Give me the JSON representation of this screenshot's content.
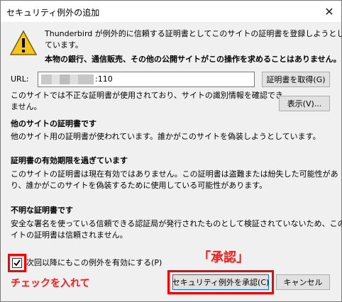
{
  "window": {
    "title": "セキュリティ例外の追加"
  },
  "intro": {
    "line1": "Thunderbird が例外的に信頼する証明書としてこのサイトの証明書を登録しようとし",
    "line2": "ています。",
    "bold": "本物の銀行、通信販売、その他の公開サイトがこの操作を求めることはありません。"
  },
  "url": {
    "label": "URL:",
    "value_suffix": ":110",
    "get_button": "証明書を取得(G)"
  },
  "status": {
    "line1": "このサイトでは不正な証明書が使用されており、サイトの識別情報を確認でき",
    "line2": "ません。",
    "view_button": "表示(V)..."
  },
  "sections": [
    {
      "title": "他のサイトの証明書です",
      "lines": [
        "他のサイト用の証明書が使われています。誰かがこのサイトを偽装しようとしています。"
      ]
    },
    {
      "title": "証明書の有効期限を過ぎています",
      "lines": [
        "このサイトの証明書は現在有効ではありません。この証明書は盗難または紛失した可能性があ",
        "り、誰かがこのサイトを偽装するために使用している可能性があります。"
      ]
    },
    {
      "title": "不明な証明書です",
      "lines": [
        "安全な署名を使っている信頼できる認証局が発行されたものとして検証されていないため、このサ",
        "イトの証明書は信頼されません。"
      ]
    }
  ],
  "footer": {
    "checkbox_label": "次回以降にもこの例外を有効にする(P)",
    "confirm_button": "セキュリティ例外を承認(C)",
    "cancel_button": "キャンセル"
  },
  "annotations": {
    "approve": "「承認」",
    "check": "チェックを入れて",
    "color": "#ff0000"
  }
}
